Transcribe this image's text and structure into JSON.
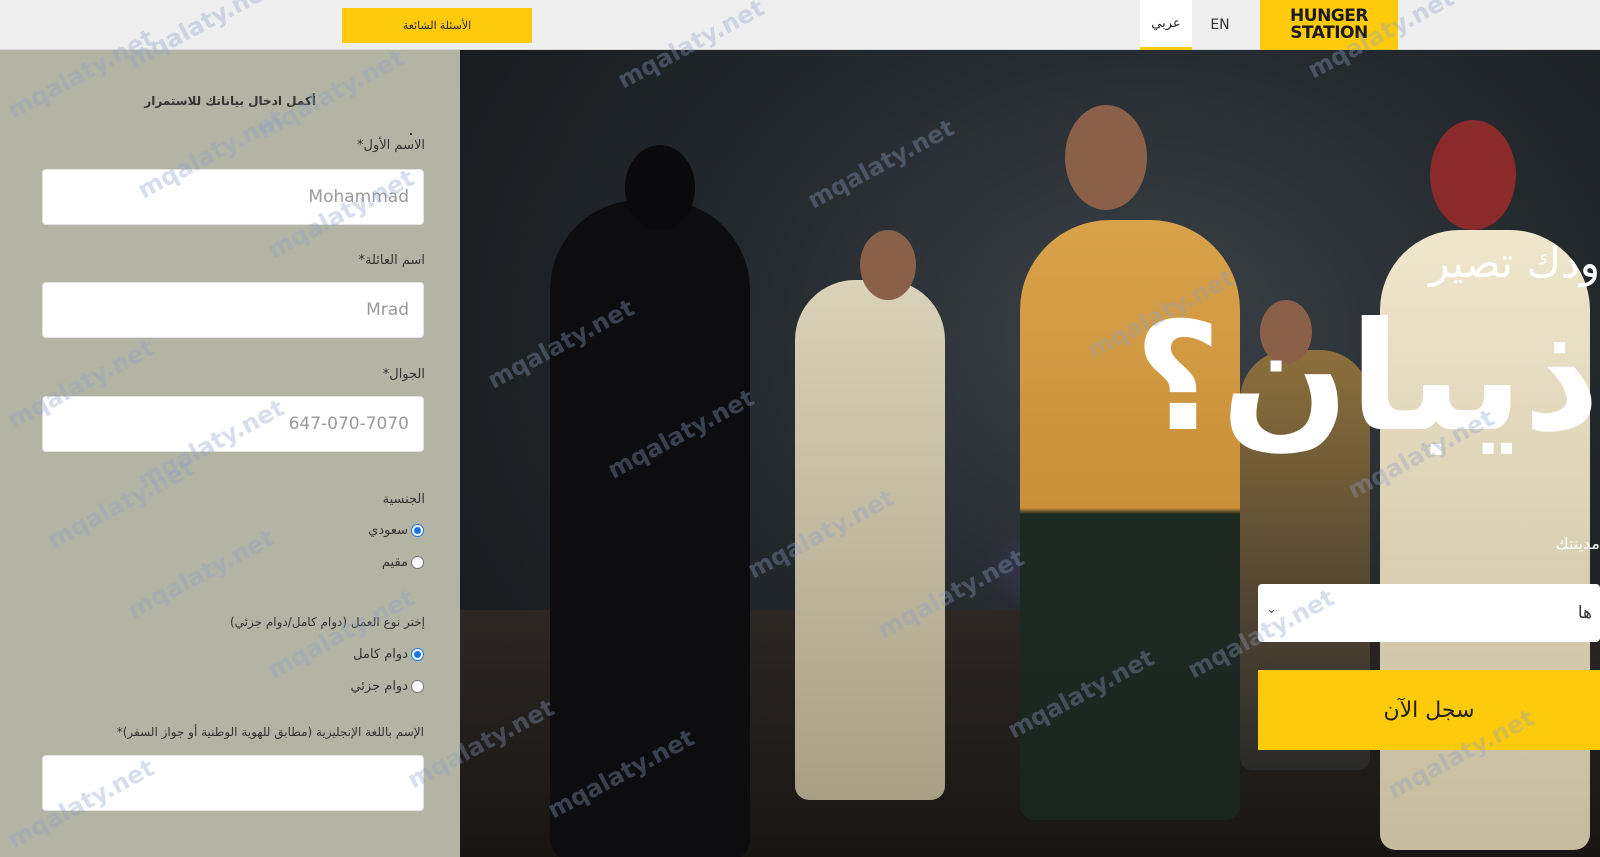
{
  "header": {
    "faq_label": "الأسئلة الشائعة",
    "lang_ar_label": "عربي",
    "lang_en_label": "EN",
    "logo_line1": "HUNGER",
    "logo_line2": "STATION",
    "accent_color": "#fdcb0c"
  },
  "form": {
    "title": "أكمل ادخال بياناتك للاستمرار",
    "first_name": {
      "label": "الاسم الأول*",
      "placeholder": "Mohammad"
    },
    "last_name": {
      "label": "اسم العائلة*",
      "placeholder": "Mrad"
    },
    "mobile": {
      "label": "الجوال*",
      "placeholder": "647-070-7070"
    },
    "nationality": {
      "label": "الجنسية",
      "options": [
        {
          "label": "سعودي",
          "selected": true
        },
        {
          "label": "مقيم",
          "selected": false
        }
      ]
    },
    "work_type": {
      "label": "إختر نوع العمل (دوام كامل/دوام جزئي)",
      "options": [
        {
          "label": "دوام كامل",
          "selected": true
        },
        {
          "label": "دوام جزئي",
          "selected": false
        }
      ]
    },
    "english_name": {
      "label": "الإسم باللغة الإنجليزية (مطابق للهوية الوطنية أو جواز السفر)*",
      "placeholder": ""
    }
  },
  "hero": {
    "subtitle": "ودك تصير",
    "headline": "ذيبان؟",
    "city_label": "مدينتك",
    "city_value": "ها",
    "signup_label": "سجل الآن"
  },
  "watermark": "mqalaty.net"
}
